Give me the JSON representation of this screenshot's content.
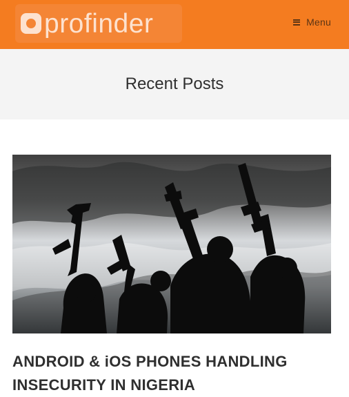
{
  "header": {
    "logo_text": "profinder",
    "menu_label": "Menu",
    "menu_icon": "hamburger-icon"
  },
  "hero": {
    "title": "Recent Posts"
  },
  "post": {
    "title": "ANDROID & iOS PHONES HANDLING INSECURITY IN NIGERIA"
  },
  "colors": {
    "header_bg": "#f47c20",
    "hero_bg": "#f4f4f4",
    "text": "#2f2f2f"
  }
}
